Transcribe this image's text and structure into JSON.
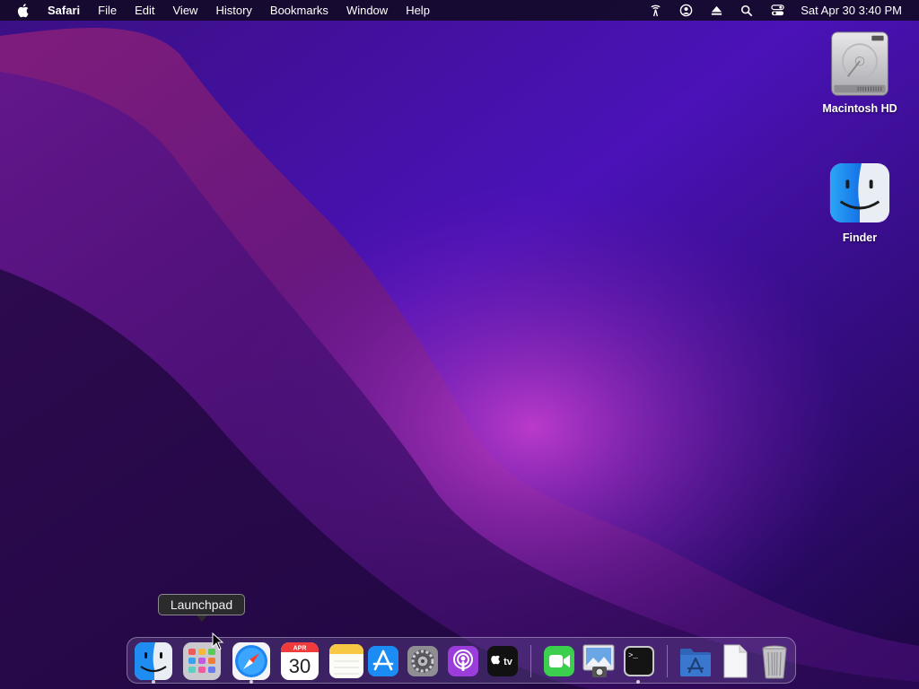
{
  "menubar": {
    "apple_icon": "apple-logo-icon",
    "app_name": "Safari",
    "items": [
      "File",
      "Edit",
      "View",
      "History",
      "Bookmarks",
      "Window",
      "Help"
    ],
    "status_icons": [
      "broadcast-icon",
      "user-account-icon",
      "eject-icon",
      "search-icon",
      "control-center-icon"
    ],
    "clock": "Sat Apr 30  3:40 PM"
  },
  "desktop": {
    "icons": [
      {
        "label": "Macintosh HD",
        "icon": "hard-drive-icon"
      },
      {
        "label": "Finder",
        "icon": "finder-icon"
      }
    ]
  },
  "tooltip": {
    "text": "Launchpad"
  },
  "dock": {
    "apps": [
      {
        "name": "Finder",
        "icon": "finder-icon",
        "running": true
      },
      {
        "name": "Launchpad",
        "icon": "launchpad-icon",
        "running": false
      },
      {
        "name": "Safari",
        "icon": "safari-icon",
        "running": true
      },
      {
        "name": "Calendar",
        "icon": "calendar-icon",
        "running": false,
        "month": "APR",
        "day": "30"
      },
      {
        "name": "Notes",
        "icon": "notes-icon",
        "running": false
      },
      {
        "name": "App Store",
        "icon": "app-store-icon",
        "running": false
      },
      {
        "name": "System Preferences",
        "icon": "system-preferences-icon",
        "running": false
      },
      {
        "name": "Podcasts",
        "icon": "podcasts-icon",
        "running": false
      },
      {
        "name": "TV",
        "icon": "apple-tv-icon",
        "running": false,
        "label": "tv"
      },
      {
        "name": "FaceTime",
        "icon": "facetime-icon",
        "running": false
      },
      {
        "name": "Preview",
        "icon": "preview-icon",
        "running": false
      },
      {
        "name": "Terminal",
        "icon": "terminal-icon",
        "running": true,
        "prompt": ">_"
      },
      {
        "name": "Applications",
        "icon": "applications-folder-icon",
        "running": false
      },
      {
        "name": "Document",
        "icon": "document-icon",
        "running": false
      },
      {
        "name": "Trash",
        "icon": "trash-icon",
        "running": false
      }
    ]
  }
}
